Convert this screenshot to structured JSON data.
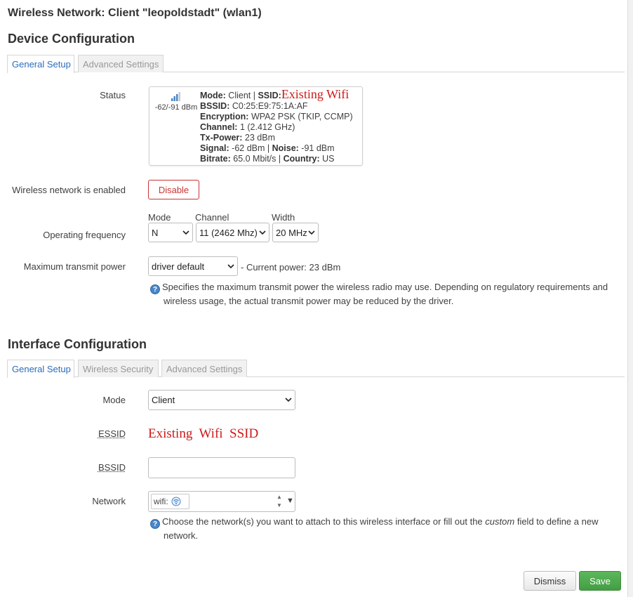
{
  "modal_title": "Wireless Network: Client \"leopoldstadt\" (wlan1)",
  "device": {
    "section_title": "Device Configuration",
    "tabs": [
      "General Setup",
      "Advanced Settings"
    ],
    "status": {
      "label": "Status",
      "signal_text": "-62/-91 dBm",
      "mode_label": "Mode:",
      "mode_value": "Client |",
      "ssid_label": "SSID:",
      "ssid_value": "Existing  Wifi",
      "bssid_label": "BSSID:",
      "bssid_value": "C0:25:E9:75:1A:AF",
      "encryption_label": "Encryption:",
      "encryption_value": "WPA2 PSK (TKIP, CCMP)",
      "channel_label": "Channel:",
      "channel_value": "1 (2.412 GHz)",
      "txpower_label": "Tx-Power:",
      "txpower_value": "23 dBm",
      "signal_label": "Signal:",
      "signal_value": "-62 dBm |",
      "noise_label": "Noise:",
      "noise_value": "-91 dBm",
      "bitrate_label": "Bitrate:",
      "bitrate_value": "65.0 Mbit/s |",
      "country_label": "Country:",
      "country_value": "US"
    },
    "enabled": {
      "label": "Wireless network is enabled",
      "button": "Disable"
    },
    "frequency": {
      "label": "Operating frequency",
      "mode_label": "Mode",
      "mode_value": "N",
      "channel_label": "Channel",
      "channel_value": "11 (2462 Mhz)",
      "width_label": "Width",
      "width_value": "20 MHz"
    },
    "txpower": {
      "label": "Maximum transmit power",
      "value": "driver default",
      "current": "- Current power: 23 dBm",
      "help_line1": "Specifies the maximum transmit power the wireless radio may use. Depending on regulatory requirements and",
      "help_line2": "wireless usage, the actual transmit power may be reduced by the driver."
    }
  },
  "interface": {
    "section_title": "Interface Configuration",
    "tabs": [
      "General Setup",
      "Wireless Security",
      "Advanced Settings"
    ],
    "mode": {
      "label": "Mode",
      "value": "Client"
    },
    "essid": {
      "label": "ESSID",
      "value": "Existing  Wifi  SSID"
    },
    "bssid": {
      "label": "BSSID",
      "value": ""
    },
    "network": {
      "label": "Network",
      "chip": "wifi:",
      "help_line1_a": "Choose the network(s) you want to attach to this wireless interface or fill out the",
      "help_line1_em": "custom",
      "help_line1_b": "field to define a new",
      "help_line2": "network."
    }
  },
  "footer": {
    "dismiss": "Dismiss",
    "save": "Save"
  }
}
